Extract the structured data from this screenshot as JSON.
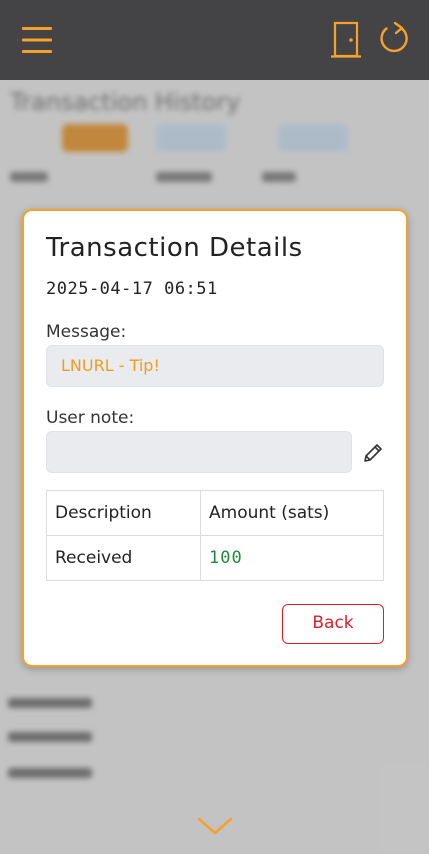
{
  "topbar": {
    "menu_icon": "hamburger-menu-icon",
    "logout_icon": "door-icon",
    "refresh_icon": "refresh-icon",
    "accent_color": "#f7a12b"
  },
  "background_page": {
    "title": "Transaction History"
  },
  "modal": {
    "title": "Transaction Details",
    "datetime": "2025-04-17 06:51",
    "message_label": "Message:",
    "message_value": "LNURL - Tip!",
    "user_note_label": "User note:",
    "user_note_value": "",
    "edit_icon": "pencil-icon",
    "table": {
      "headers": [
        "Description",
        "Amount (sats)"
      ],
      "rows": [
        [
          "Received",
          "100"
        ]
      ]
    },
    "back_label": "Back",
    "colors": {
      "border": "#f7a12b",
      "message_text": "#f29c1f",
      "amount_text": "#1f8a3c",
      "back_button": "#d9212c"
    }
  },
  "footer": {
    "scroll_icon": "chevron-down-icon"
  }
}
